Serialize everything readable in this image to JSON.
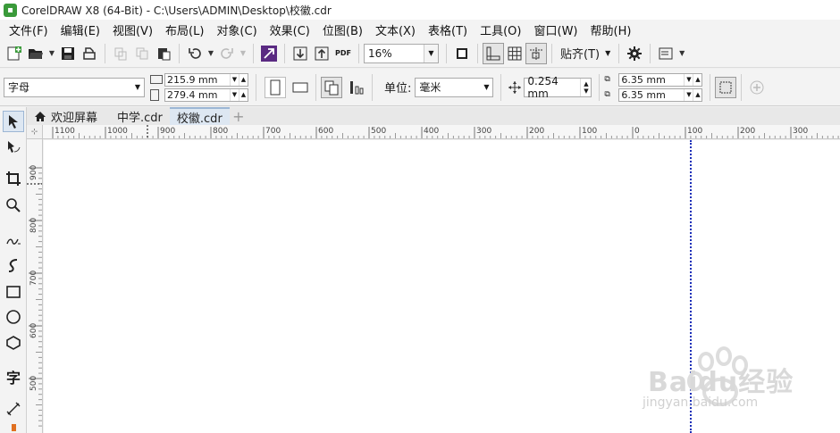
{
  "window": {
    "title": "CorelDRAW X8 (64-Bit) - C:\\Users\\ADMIN\\Desktop\\校徽.cdr"
  },
  "menu": [
    {
      "label": "文件(F)"
    },
    {
      "label": "编辑(E)"
    },
    {
      "label": "视图(V)"
    },
    {
      "label": "布局(L)"
    },
    {
      "label": "对象(C)"
    },
    {
      "label": "效果(C)"
    },
    {
      "label": "位图(B)"
    },
    {
      "label": "文本(X)"
    },
    {
      "label": "表格(T)"
    },
    {
      "label": "工具(O)"
    },
    {
      "label": "窗口(W)"
    },
    {
      "label": "帮助(H)"
    }
  ],
  "toolbar": {
    "zoom": "16%",
    "snap_label": "贴齐(T)",
    "pdf_label": "PDF"
  },
  "property_bar": {
    "page_size": "字母",
    "width": "215.9 mm",
    "height": "279.4 mm",
    "unit_label": "单位:",
    "unit": "毫米",
    "nudge": "0.254 mm",
    "dup_x": "6.35 mm",
    "dup_y": "6.35 mm"
  },
  "tabs": [
    {
      "label": "欢迎屏幕"
    },
    {
      "label": "中学.cdr"
    },
    {
      "label": "校徽.cdr"
    }
  ],
  "ruler_h": [
    "1100",
    "1000",
    "900",
    "800",
    "700",
    "600",
    "500",
    "400",
    "300",
    "200",
    "100",
    "0",
    "100",
    "200",
    "300"
  ],
  "ruler_v": [
    "900",
    "800",
    "700",
    "600",
    "500"
  ],
  "watermark": {
    "text": "Baidu经验",
    "sub": "jingyan.baidu.com"
  },
  "colors": {
    "guide": "#1a2fb8",
    "accent_logo": "#3a9a3a"
  }
}
